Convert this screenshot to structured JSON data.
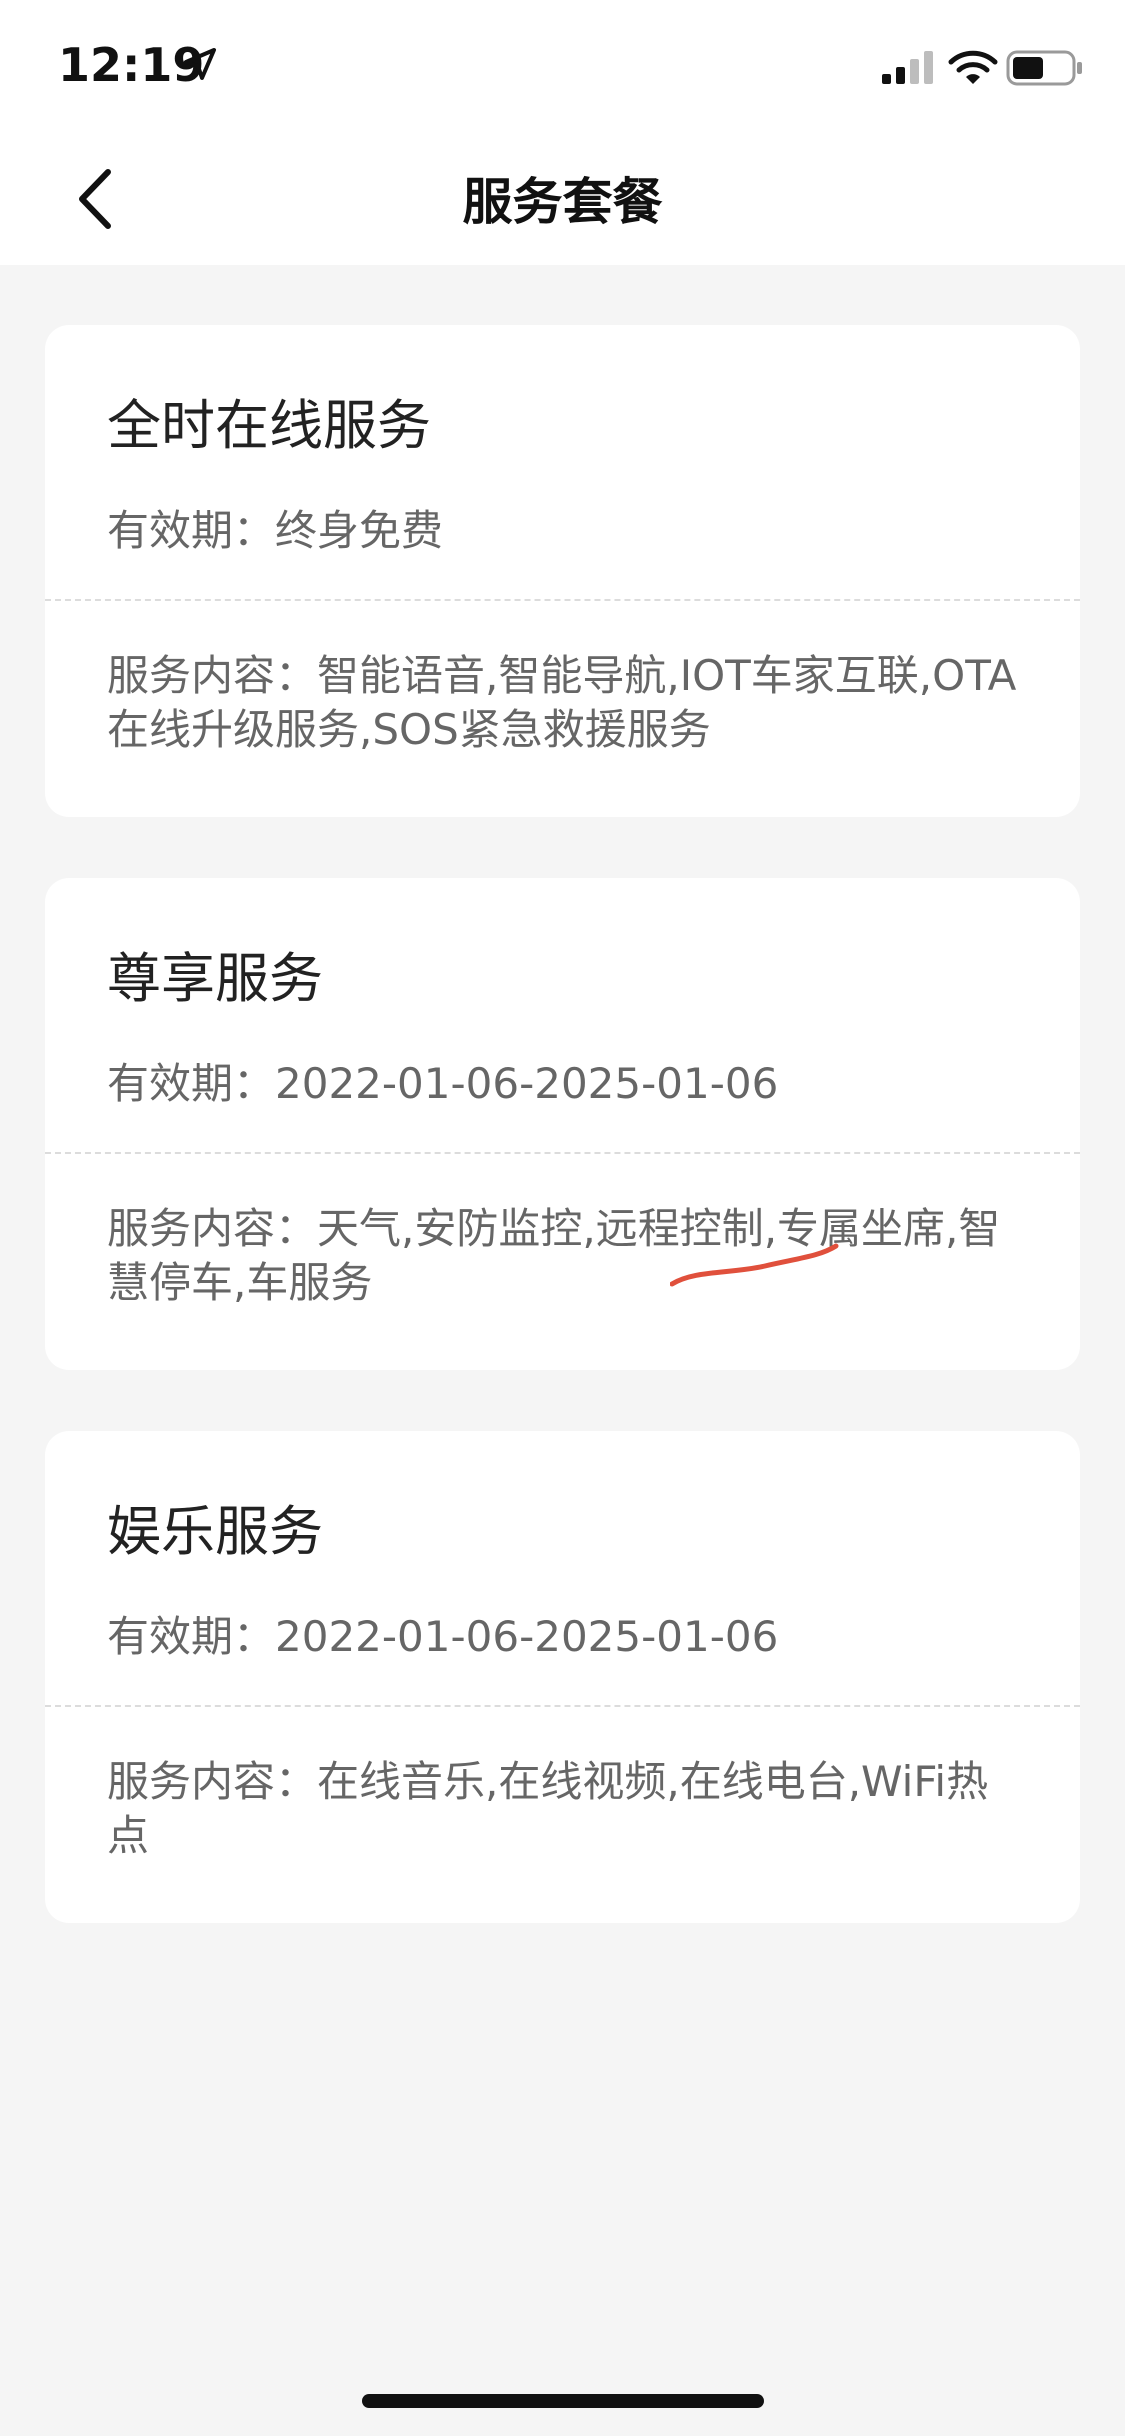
{
  "status_bar": {
    "time": "12:19"
  },
  "nav": {
    "title": "服务套餐"
  },
  "cards": [
    {
      "title": "全时在线服务",
      "validity": "有效期：终身免费",
      "content": "服务内容：智能语音,智能导航,IOT车家互联,OTA在线升级服务,SOS紧急救援服务"
    },
    {
      "title": "尊享服务",
      "validity": "有效期：2022-01-06-2025-01-06",
      "content": "服务内容：天气,安防监控,远程控制,专属坐席,智慧停车,车服务"
    },
    {
      "title": "娱乐服务",
      "validity": "有效期：2022-01-06-2025-01-06",
      "content": "服务内容：在线音乐,在线视频,在线电台,WiFi热点"
    }
  ],
  "colors": {
    "background": "#f5f5f5",
    "card": "#ffffff",
    "annotation": "#e0503c"
  },
  "icons": {
    "back": "chevron-left-icon",
    "location": "location-arrow-icon",
    "signal": "signal-icon",
    "wifi": "wifi-icon",
    "battery": "battery-icon"
  }
}
